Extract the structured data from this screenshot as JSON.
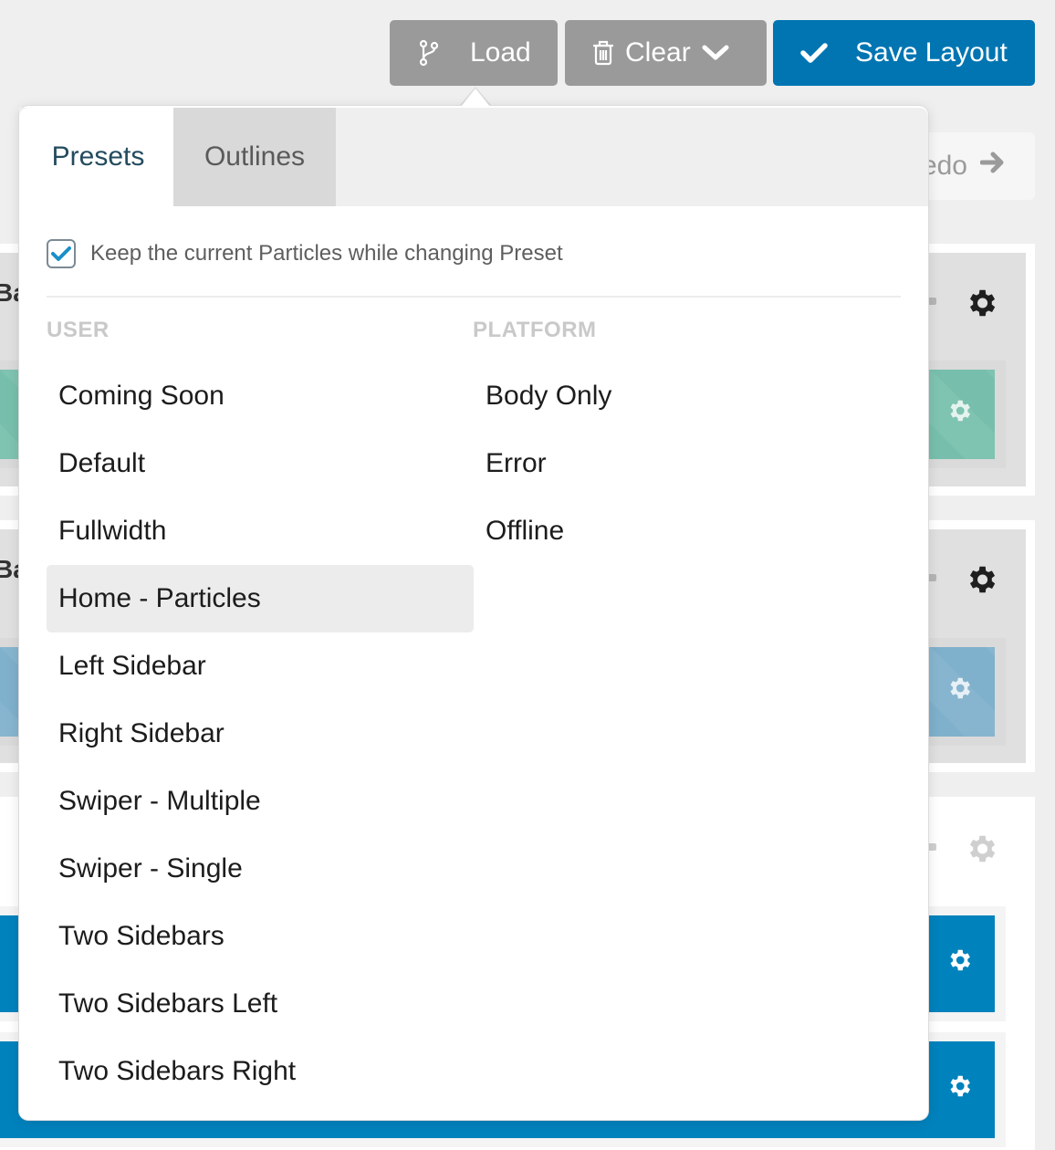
{
  "toolbar": {
    "load_label": "Load",
    "clear_label": "Clear",
    "save_label": "Save Layout",
    "colors": {
      "gray_button": "#9a9a9a",
      "save_button": "#0075b2"
    }
  },
  "background": {
    "redo_label": "edo",
    "sections": [
      {
        "title_fragment": "Ba",
        "block_value_fragment": "%",
        "block_color": "#77bfac"
      },
      {
        "title_fragment": "Ba",
        "block_value_fragment": "%",
        "block_color": "#7fb0cc"
      },
      {
        "title_fragment": "",
        "block_value_fragment": "%",
        "block_color": "#0082bd"
      },
      {
        "title_fragment": "",
        "block_value_fragment": "%",
        "block_color": "#0082bd"
      }
    ]
  },
  "popover": {
    "tabs": [
      {
        "label": "Presets",
        "active": true
      },
      {
        "label": "Outlines",
        "active": false
      }
    ],
    "keep_particles": {
      "label": "Keep the current Particles while changing Preset",
      "checked": true
    },
    "user": {
      "heading": "USER",
      "items": [
        "Coming Soon",
        "Default",
        "Fullwidth",
        "Home - Particles",
        "Left Sidebar",
        "Right Sidebar",
        "Swiper - Multiple",
        "Swiper - Single",
        "Two Sidebars",
        "Two Sidebars Left",
        "Two Sidebars Right"
      ],
      "hovered_item": "Home - Particles"
    },
    "platform": {
      "heading": "PLATFORM",
      "items": [
        "Body Only",
        "Error",
        "Offline"
      ]
    },
    "colors": {
      "active_tab_text": "#234b5e",
      "checkbox_check": "#1a8fc8"
    }
  }
}
